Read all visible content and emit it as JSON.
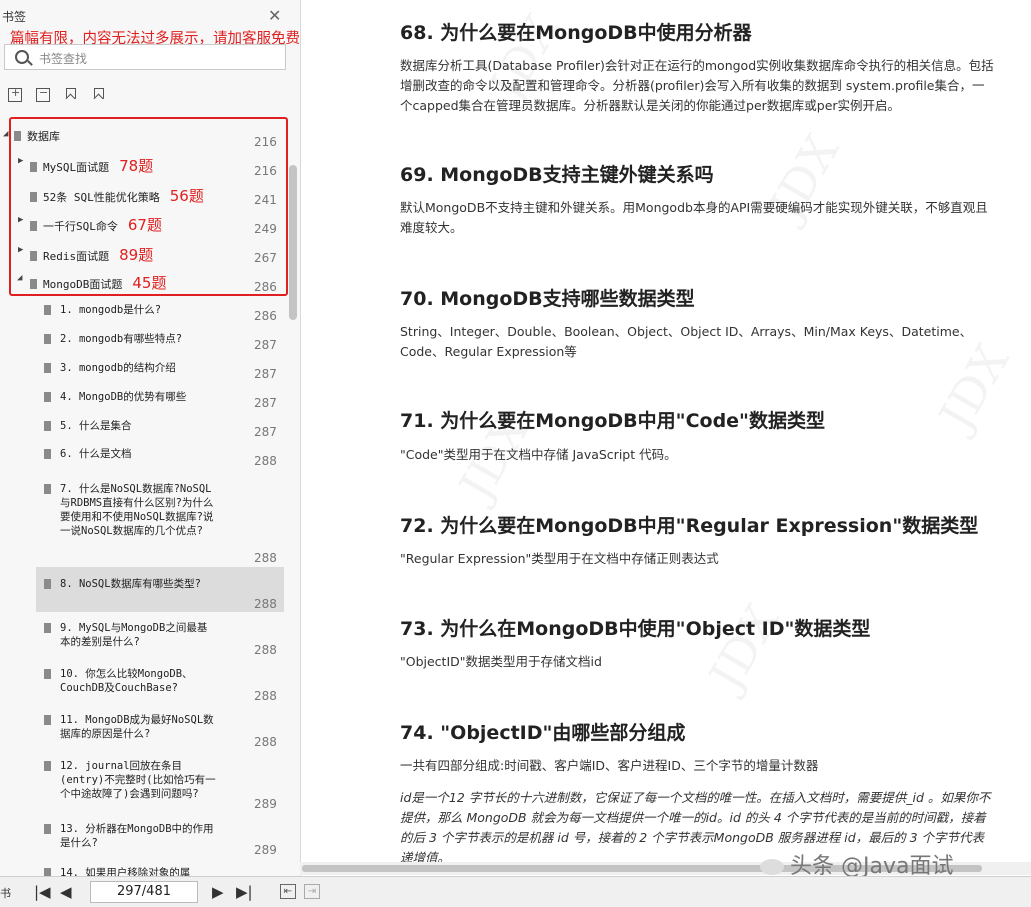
{
  "sidebar": {
    "title": "书签",
    "promo": "篇幅有限，内容无法过多展示，请加客服免费领取",
    "search_placeholder": "书签查找",
    "groups": [
      {
        "label": "数据库",
        "page": "216",
        "count": ""
      },
      {
        "label": "MySQL面试题",
        "page": "216",
        "count": "78题"
      },
      {
        "label": "52条 SQL性能优化策略",
        "page": "241",
        "count": "56题"
      },
      {
        "label": "一千行SQL命令",
        "page": "249",
        "count": "67题"
      },
      {
        "label": "Redis面试题",
        "page": "267",
        "count": "89题"
      },
      {
        "label": "MongoDB面试题",
        "page": "286",
        "count": "45题"
      }
    ],
    "items": [
      {
        "label": "1. mongodb是什么?",
        "page": "286"
      },
      {
        "label": "2. mongodb有哪些特点?",
        "page": "287"
      },
      {
        "label": "3. mongodb的结构介绍",
        "page": "287"
      },
      {
        "label": "4. MongoDB的优势有哪些",
        "page": "287"
      },
      {
        "label": "5. 什么是集合",
        "page": "287"
      },
      {
        "label": "6. 什么是文档",
        "page": "288"
      },
      {
        "label": "7. 什么是NoSQL数据库?NoSQL与RDBMS直接有什么区别?为什么要使用和不使用NoSQL数据库?说一说NoSQL数据库的几个优点?",
        "page": "288"
      },
      {
        "label": "8. NoSQL数据库有哪些类型?",
        "page": "288"
      },
      {
        "label": "9. MySQL与MongoDB之间最基本的差别是什么?",
        "page": "288"
      },
      {
        "label": "10. 你怎么比较MongoDB、CouchDB及CouchBase?",
        "page": "288"
      },
      {
        "label": "11. MongoDB成为最好NoSQL数据库的原因是什么?",
        "page": "288"
      },
      {
        "label": "12. journal回放在条目(entry)不完整时(比如恰巧有一个中途故障了)会遇到问题吗?",
        "page": "289"
      },
      {
        "label": "13. 分析器在MongoDB中的作用是什么?",
        "page": "289"
      },
      {
        "label": "14. 如果用户移除对象的属",
        "page": ""
      }
    ]
  },
  "toolbar": {
    "page_indicator": "297/481",
    "left_char": "书"
  },
  "doc": {
    "sections": [
      {
        "heading": "68. 为什么要在MongoDB中使用分析器",
        "body": "数据库分析工具(Database Profiler)会针对正在运行的mongod实例收集数据库命令执行的相关信息。包括增删改查的命令以及配置和管理命令。分析器(profiler)会写入所有收集的数据到 system.profile集合，一个capped集合在管理员数据库。分析器默认是关闭的你能通过per数据库或per实例开启。"
      },
      {
        "heading": "69. MongoDB支持主键外键关系吗",
        "body": "默认MongoDB不支持主键和外键关系。用Mongodb本身的API需要硬编码才能实现外键关联，不够直观且难度较大。"
      },
      {
        "heading": "70. MongoDB支持哪些数据类型",
        "body": "String、Integer、Double、Boolean、Object、Object ID、Arrays、Min/Max Keys、Datetime、Code、Regular Expression等"
      },
      {
        "heading": "71. 为什么要在MongoDB中用\"Code\"数据类型",
        "body": "\"Code\"类型用于在文档中存储 JavaScript 代码。"
      },
      {
        "heading": "72. 为什么要在MongoDB中用\"Regular Expression\"数据类型",
        "body": "\"Regular Expression\"类型用于在文档中存储正则表达式"
      },
      {
        "heading": "73. 为什么在MongoDB中使用\"Object ID\"数据类型",
        "body": "\"ObjectID\"数据类型用于存储文档id"
      },
      {
        "heading": "74. \"ObjectID\"由哪些部分组成",
        "body": "一共有四部分组成:时间戳、客户端ID、客户进程ID、三个字节的增量计数器"
      }
    ],
    "italic_para": "id是一个12 字节长的十六进制数，它保证了每一个文档的唯一性。在插入文档时，需要提供_id 。如果你不提供，那么 MongoDB 就会为每一文档提供一个唯一的id。id 的头 4 个字节代表的是当前的时间戳，接着的后 3 个字节表示的是机器 id 号，接着的 2 个字节表示MongoDB 服务器进程 id，最后的 3 个字节代表递增值。",
    "watermark": "JDX",
    "footer_watermark": "头条 @Java面试"
  },
  "colors": {
    "highlight": "#e02020",
    "sidebar_bg": "#f7f7f7"
  }
}
